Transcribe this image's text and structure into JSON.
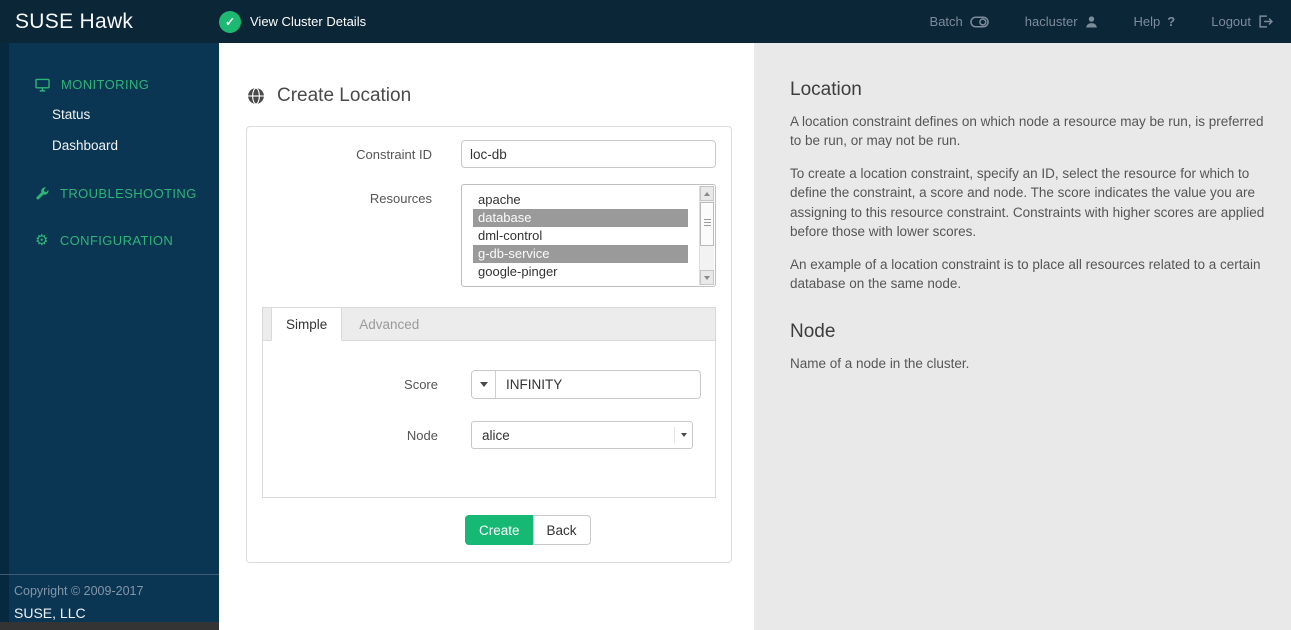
{
  "topbar": {
    "brand": "SUSE Hawk",
    "cluster_status_label": "View Cluster Details",
    "batch_label": "Batch",
    "user_label": "hacluster",
    "help_label": "Help",
    "logout_label": "Logout"
  },
  "sidebar": {
    "sections": [
      {
        "label": "MONITORING",
        "icon": "monitor-icon",
        "items": [
          "Status",
          "Dashboard"
        ]
      },
      {
        "label": "TROUBLESHOOTING",
        "icon": "wrench-icon",
        "items": []
      },
      {
        "label": "CONFIGURATION",
        "icon": "gear-icon",
        "items": []
      }
    ],
    "footer": {
      "copyright": "Copyright © 2009-2017",
      "company": "SUSE, LLC"
    }
  },
  "main": {
    "title": "Create Location",
    "title_icon": "globe-icon",
    "form": {
      "constraint_id": {
        "label": "Constraint ID",
        "value": "loc-db"
      },
      "resources": {
        "label": "Resources",
        "options": [
          {
            "name": "apache",
            "selected": false
          },
          {
            "name": "database",
            "selected": true
          },
          {
            "name": "dml-control",
            "selected": false
          },
          {
            "name": "g-db-service",
            "selected": true
          },
          {
            "name": "google-pinger",
            "selected": false
          }
        ]
      },
      "tabs": [
        {
          "label": "Simple",
          "active": true
        },
        {
          "label": "Advanced",
          "active": false
        }
      ],
      "score": {
        "label": "Score",
        "value": "INFINITY"
      },
      "node": {
        "label": "Node",
        "value": "alice"
      },
      "buttons": {
        "create": "Create",
        "back": "Back"
      }
    }
  },
  "help_panel": {
    "location": {
      "heading": "Location",
      "paragraphs": [
        "A location constraint defines on which node a resource may be run, is preferred to be run, or may not be run.",
        "To create a location constraint, specify an ID, select the resource for which to define the constraint, a score and node. The score indicates the value you are assigning to this resource constraint. Constraints with higher scores are applied before those with lower scores.",
        "An example of a location constraint is to place all resources related to a certain database on the same node."
      ]
    },
    "node": {
      "heading": "Node",
      "paragraphs": [
        "Name of a node in the cluster."
      ]
    }
  },
  "colors": {
    "topbar_bg": "#0a2637",
    "sidebar_bg": "#0a3553",
    "nav_green": "#2db577",
    "status_green": "#1db872",
    "create_button_green": "#15b973",
    "selected_option_bg": "#9a9a9a",
    "help_panel_bg": "#e9e9e9"
  }
}
